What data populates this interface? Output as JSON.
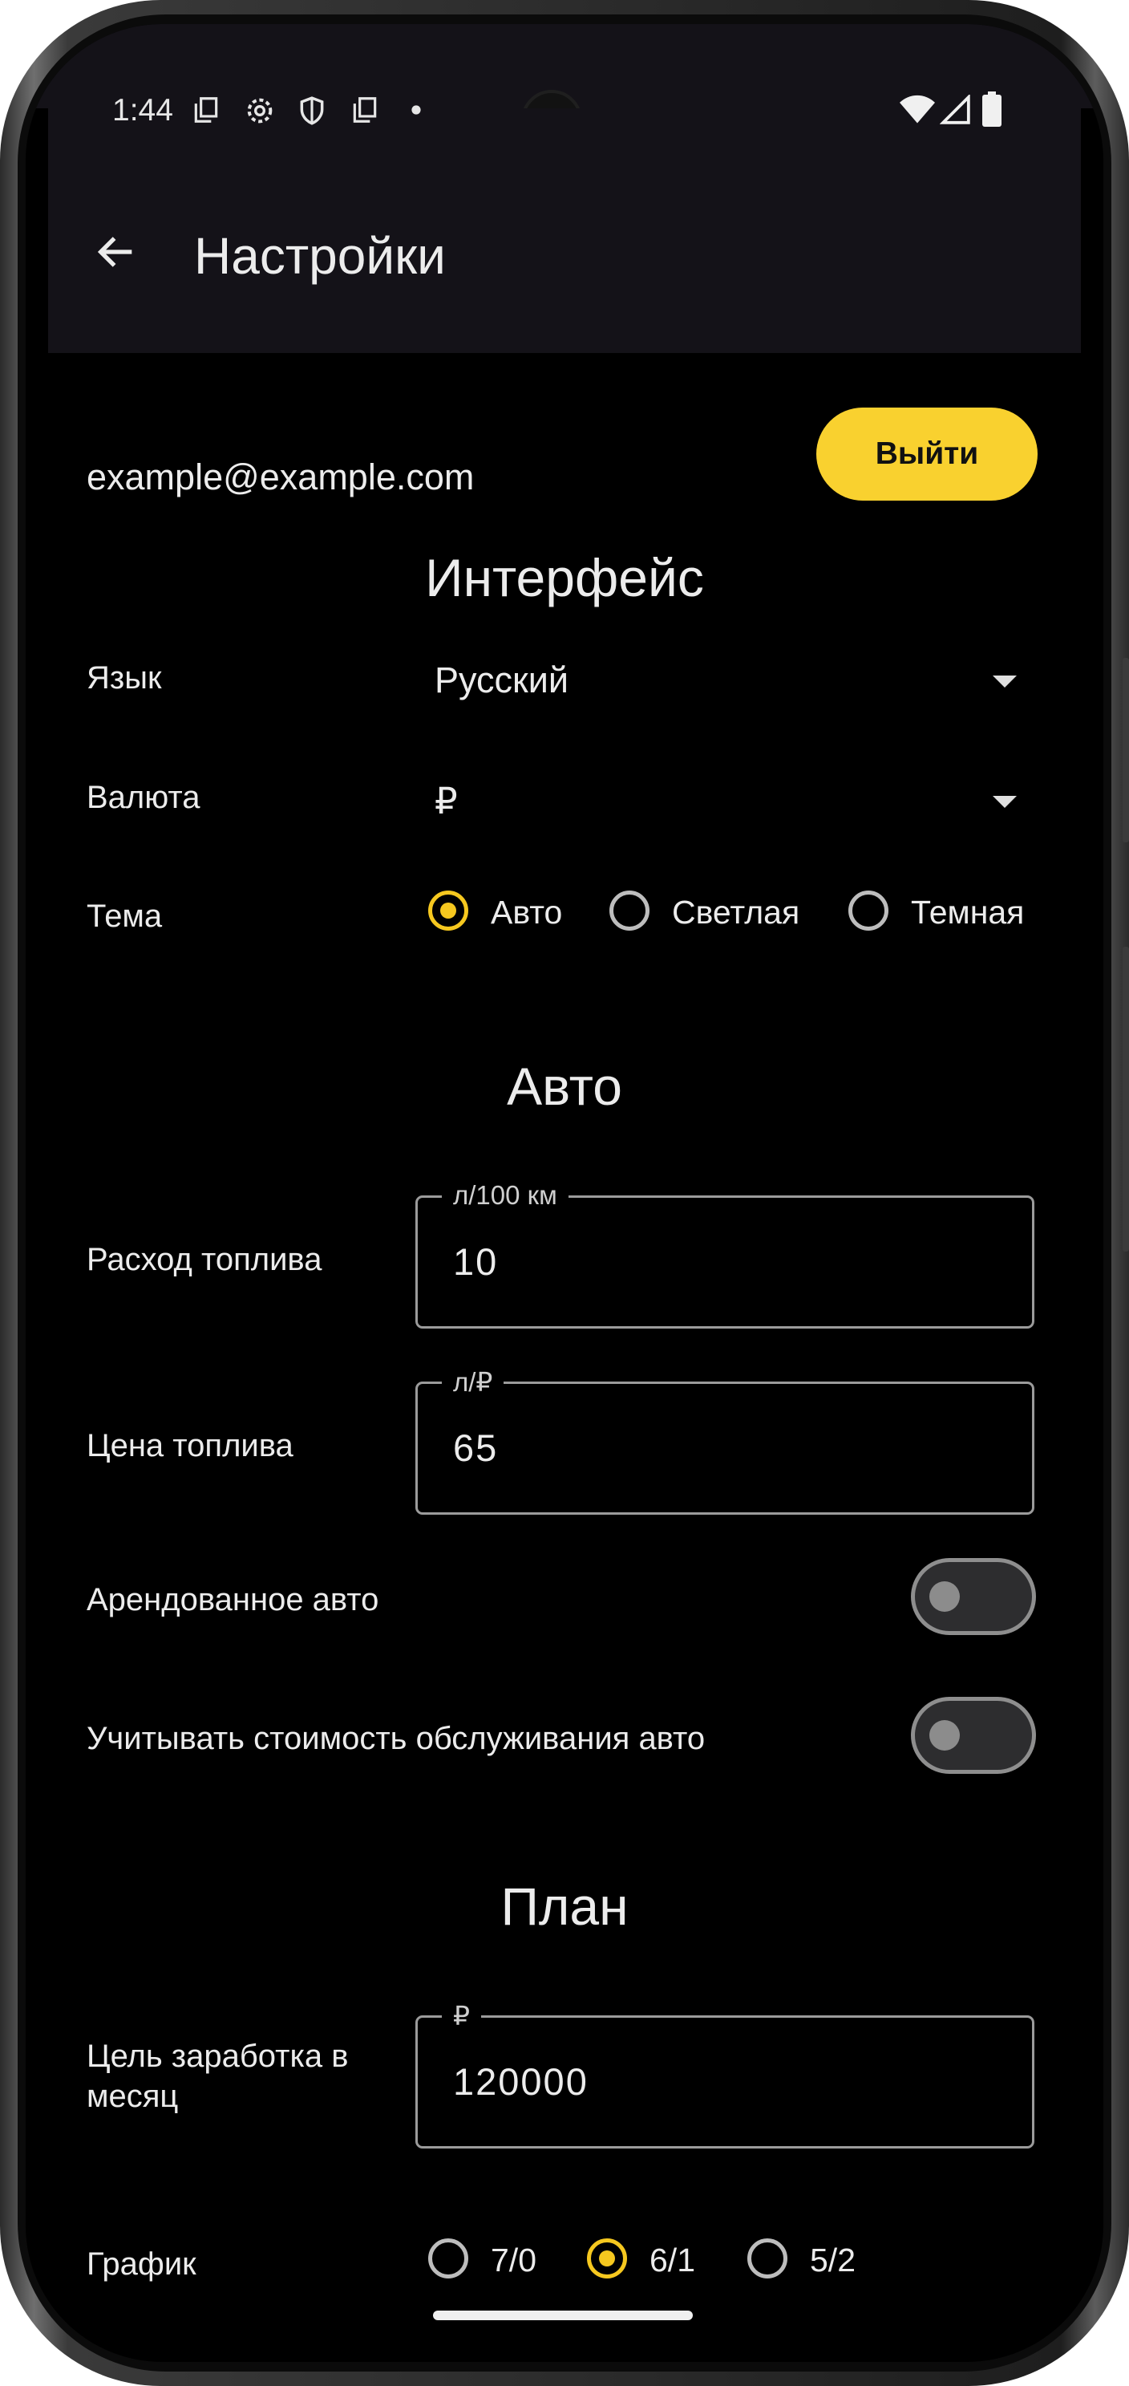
{
  "status_bar": {
    "time": "1:44",
    "left_icons": [
      "copy-icon",
      "gear-icon",
      "shield-icon",
      "copy-icon",
      "dot-icon"
    ],
    "right_icons": [
      "wifi-icon",
      "signal-icon",
      "battery-icon"
    ]
  },
  "app_bar": {
    "title": "Настройки",
    "back_icon": "arrow-left-icon"
  },
  "account": {
    "email": "example@example.com",
    "logout_label": "Выйти",
    "logout_color": "#f9d12f"
  },
  "interface": {
    "heading": "Интерфейс",
    "language_label": "Язык",
    "language_value": "Русский",
    "currency_label": "Валюта",
    "currency_value": "₽",
    "theme_label": "Тема",
    "theme_options": [
      "Авто",
      "Светлая",
      "Темная"
    ],
    "theme_selected": "Авто"
  },
  "auto": {
    "heading": "Авто",
    "fuel_consumption_label": "Расход топлива",
    "fuel_consumption_unit": "л/100 км",
    "fuel_consumption_value": "10",
    "fuel_price_label": "Цена топлива",
    "fuel_price_unit": "л/₽",
    "fuel_price_value": "65",
    "rented_car_label": "Арендованное авто",
    "rented_car_on": false,
    "maintenance_label": "Учитывать стоимость обслуживания авто",
    "maintenance_on": false
  },
  "plan": {
    "heading": "План",
    "goal_label": "Цель заработка в месяц",
    "goal_unit": "₽",
    "goal_value": "120000",
    "schedule_label": "График",
    "schedule_options": [
      "7/0",
      "6/1",
      "5/2"
    ],
    "schedule_selected": "6/1"
  },
  "accent_color": "#f6c81f"
}
